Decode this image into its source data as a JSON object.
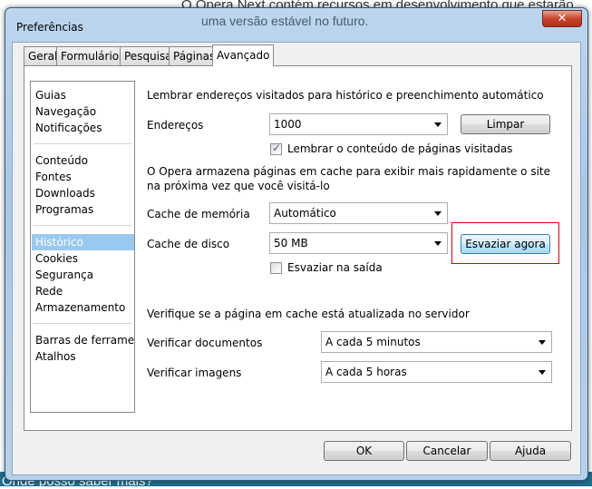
{
  "background": {
    "line1": "O Opera Next contém recursos em desenvolvimento que estarão",
    "line2": "uma versão estável no futuro.",
    "bottom": "Onde posso saber mais?"
  },
  "window": {
    "title": "Preferências",
    "close_icon": "close-icon"
  },
  "tabs": [
    {
      "label": "Geral"
    },
    {
      "label": "Formulários"
    },
    {
      "label": "Pesquisa"
    },
    {
      "label": "Páginas"
    },
    {
      "label": "Avançado",
      "active": true
    }
  ],
  "sidebar": {
    "items": [
      {
        "label": "Guias"
      },
      {
        "label": "Navegação"
      },
      {
        "label": "Notificações"
      },
      {
        "label": "Conteúdo"
      },
      {
        "label": "Fontes"
      },
      {
        "label": "Downloads"
      },
      {
        "label": "Programas"
      },
      {
        "label": "Histórico",
        "selected": true
      },
      {
        "label": "Cookies"
      },
      {
        "label": "Segurança"
      },
      {
        "label": "Rede"
      },
      {
        "label": "Armazenamento"
      },
      {
        "label": "Barras de ferramen..."
      },
      {
        "label": "Atalhos"
      }
    ],
    "selected_color": "#99c9ef"
  },
  "history": {
    "heading": "Lembrar endereços visitados para histórico e preenchimento automático",
    "addresses_label": "Endereços",
    "addresses_value": "1000",
    "clear_button": "Limpar",
    "remember_content_label": "Lembrar o conteúdo de páginas visitadas",
    "remember_content_checked": true,
    "cache_text_1": "O Opera armazena páginas em cache para exibir mais rapidamente o site",
    "cache_text_2": "na próxima vez que você visitá-lo",
    "memory_cache_label": "Cache de memória",
    "memory_cache_value": "Automático",
    "disk_cache_label": "Cache de disco",
    "disk_cache_value": "50 MB",
    "empty_now_button": "Esvaziar agora",
    "empty_on_exit_label": "Esvaziar na saída",
    "empty_on_exit_checked": false,
    "verify_heading": "Verifique se a página em cache está atualizada no servidor",
    "verify_docs_label": "Verificar documentos",
    "verify_docs_value": "A cada 5 minutos",
    "verify_images_label": "Verificar imagens",
    "verify_images_value": "A cada 5 horas",
    "highlight_color": "#e00000"
  },
  "footer": {
    "ok": "OK",
    "cancel": "Cancelar",
    "help": "Ajuda"
  }
}
